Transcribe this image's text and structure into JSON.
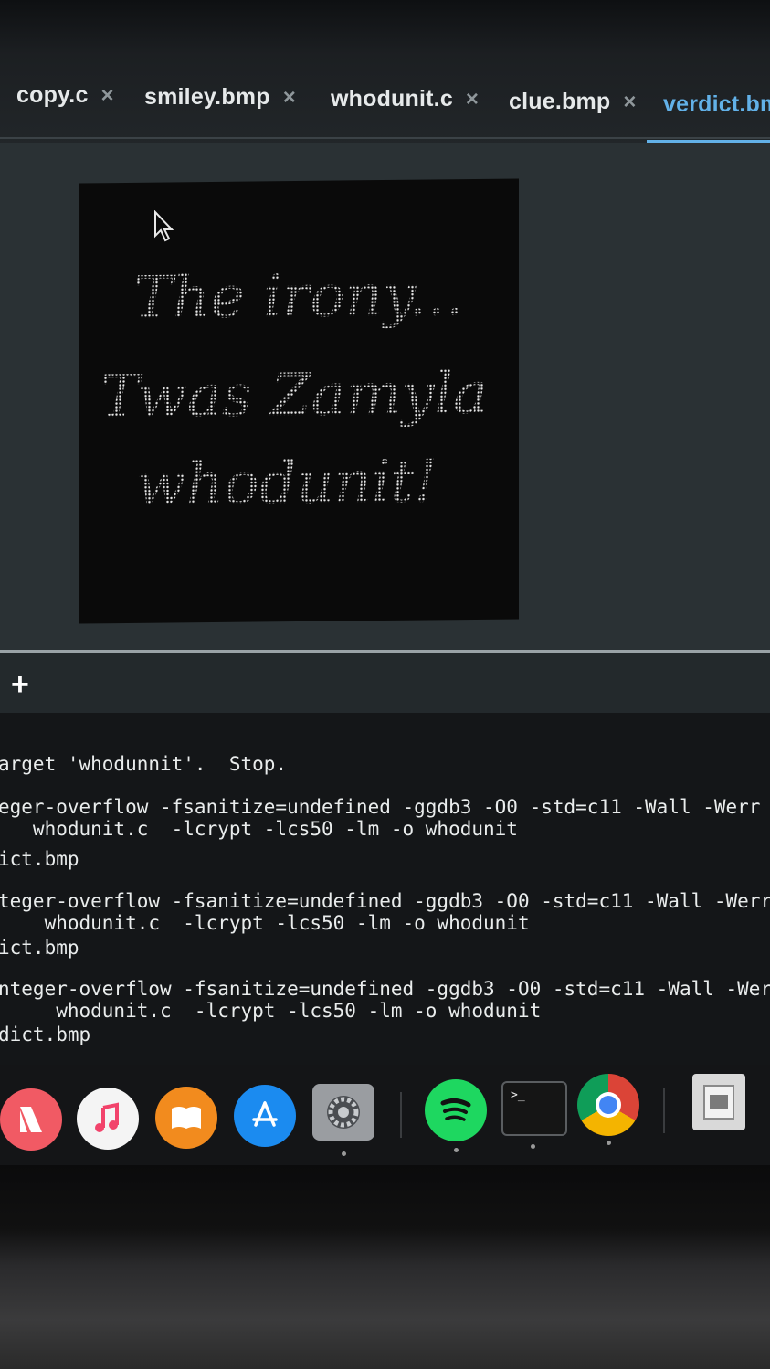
{
  "tabs": [
    {
      "label": "copy.c",
      "close": "×"
    },
    {
      "label": "smiley.bmp",
      "close": "×"
    },
    {
      "label": "whodunit.c",
      "close": "×"
    },
    {
      "label": "clue.bmp",
      "close": "×"
    },
    {
      "label": "verdict.bm",
      "active": true
    }
  ],
  "image": {
    "lines": [
      "The irony...",
      "Twas Zamyla",
      "whodunit!"
    ]
  },
  "terminal": {
    "new_tab": "+",
    "lines": [
      "arget 'whodunnit'.  Stop.",
      "eger-overflow -fsanitize=undefined -ggdb3 -O0 -std=c11 -Wall -Werr",
      "   whodunit.c  -lcrypt -lcs50 -lm -o whodunit",
      "ict.bmp",
      "teger-overflow -fsanitize=undefined -ggdb3 -O0 -std=c11 -Wall -Werro",
      "    whodunit.c  -lcrypt -lcs50 -lm -o whodunit",
      "ict.bmp",
      "nteger-overflow -fsanitize=undefined -ggdb3 -O0 -std=c11 -Wall -Werro",
      "     whodunit.c  -lcrypt -lcs50 -lm -o whodunit",
      "dict.bmp"
    ]
  },
  "dock": {
    "icons": [
      "news-icon",
      "music-icon",
      "books-icon",
      "app-store-icon",
      "system-preferences-icon",
      "spotify-icon",
      "terminal-icon",
      "chrome-icon",
      "preview-icon"
    ],
    "terminal_prompt": ">_"
  }
}
